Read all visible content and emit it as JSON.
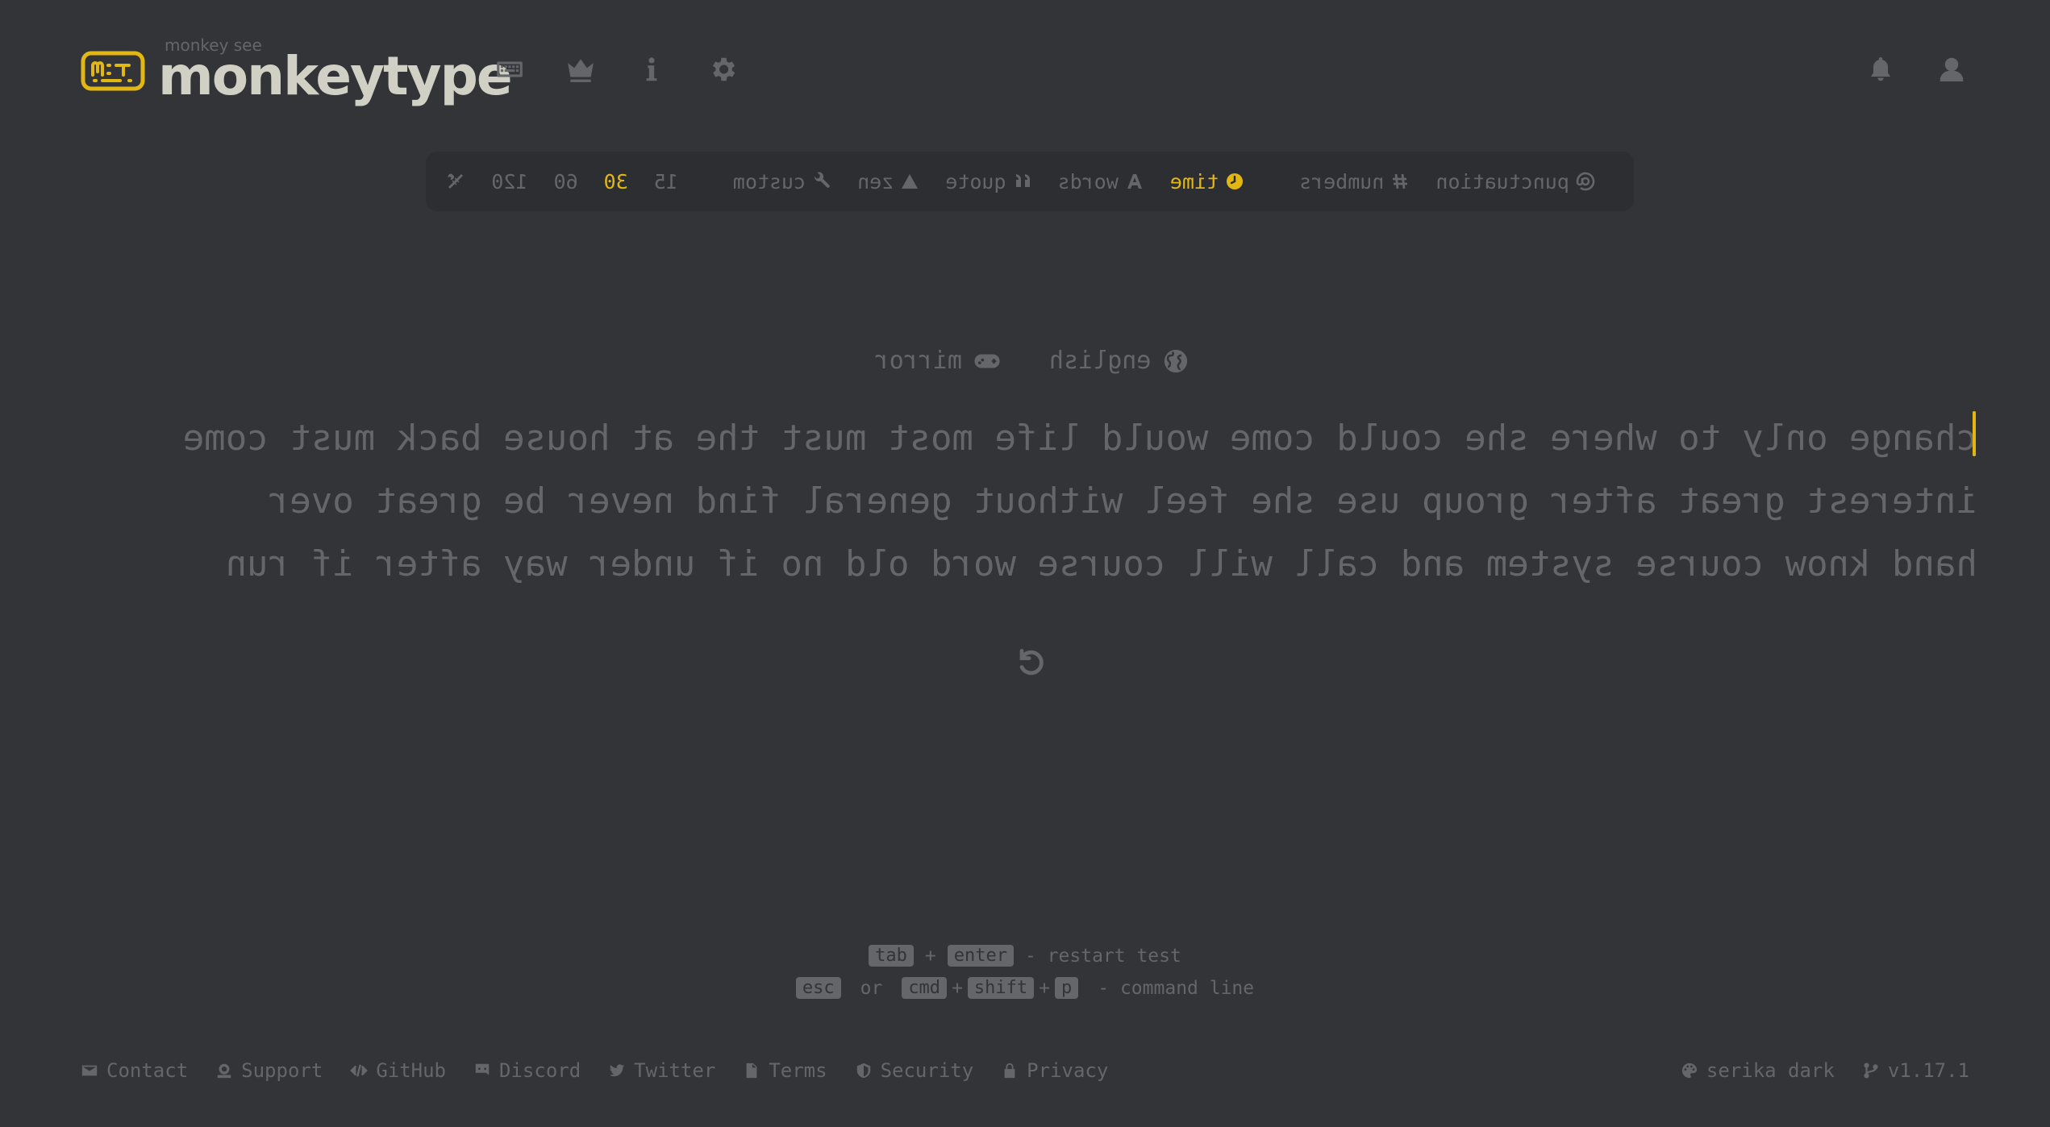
{
  "colors": {
    "bg": "#323437",
    "sub": "#646669",
    "main": "#e2b714",
    "text": "#d1d0c5",
    "subalt": "#2c2e31"
  },
  "logo": {
    "top_text": "monkey see",
    "main_text": "monkeytype"
  },
  "nav": [
    {
      "name": "keyboard-icon"
    },
    {
      "name": "crown-icon"
    },
    {
      "name": "info-icon"
    },
    {
      "name": "gear-icon"
    }
  ],
  "right_nav": [
    {
      "name": "bell-icon"
    },
    {
      "name": "user-icon"
    }
  ],
  "config": {
    "toggles": [
      {
        "label": "punctuation",
        "icon": "at-icon"
      },
      {
        "label": "numbers",
        "icon": "hash-icon"
      }
    ],
    "modes": [
      {
        "label": "time",
        "icon": "clock-icon",
        "active": true
      },
      {
        "label": "words",
        "icon": "letter-a-icon",
        "active": false
      },
      {
        "label": "quote",
        "icon": "quote-icon",
        "active": false
      },
      {
        "label": "zen",
        "icon": "mountain-icon",
        "active": false
      },
      {
        "label": "custom",
        "icon": "wrench-icon",
        "active": false
      }
    ],
    "durations": [
      {
        "label": "15",
        "active": false
      },
      {
        "label": "30",
        "active": true
      },
      {
        "label": "60",
        "active": false
      },
      {
        "label": "120",
        "active": false
      }
    ],
    "custom_icon": "tools-icon"
  },
  "test": {
    "language": "english",
    "funbox": "mirror",
    "lines": [
      "change only to where she could come would life most must the at house back must come",
      "interest great after group use she feel without general find never be great over",
      "hand know course system and call will course word old no if under way after if run"
    ]
  },
  "hints": {
    "row1": {
      "key1": "tab",
      "plus": "+",
      "key2": "enter",
      "text": "- restart test"
    },
    "row2": {
      "key1": "esc",
      "or": "or",
      "key2": "cmd",
      "plus1": "+",
      "key3": "shift",
      "plus2": "+",
      "key4": "p",
      "text": "- command line"
    }
  },
  "footer": {
    "links": [
      {
        "label": "Contact",
        "icon": "envelope-icon"
      },
      {
        "label": "Support",
        "icon": "donate-icon"
      },
      {
        "label": "GitHub",
        "icon": "code-icon"
      },
      {
        "label": "Discord",
        "icon": "discord-icon"
      },
      {
        "label": "Twitter",
        "icon": "twitter-icon"
      },
      {
        "label": "Terms",
        "icon": "file-icon"
      },
      {
        "label": "Security",
        "icon": "shield-icon"
      },
      {
        "label": "Privacy",
        "icon": "lock-icon"
      }
    ],
    "theme": "serika dark",
    "version": "v1.17.1"
  }
}
